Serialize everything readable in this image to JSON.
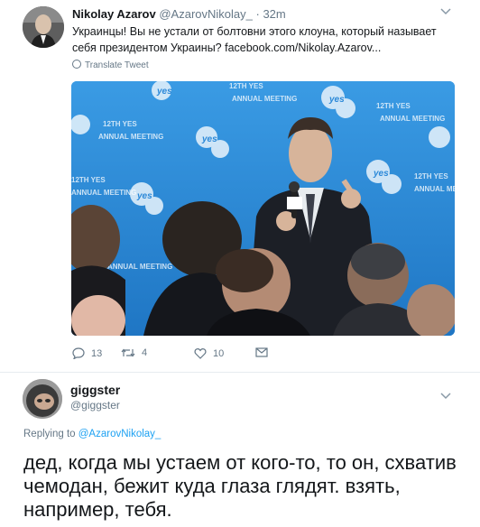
{
  "tweet1": {
    "author_name": "Nikolay Azarov",
    "author_handle": "@AzarovNikolay_",
    "time": "· 32m",
    "text": "Украинцы! Вы не устали от болтовни этого клоуна, который называет себя президентом Украины? facebook.com/Nikolay.Azarov...",
    "translate_label": "Translate Tweet",
    "photo_backdrop_texts": [
      "12TH YES",
      "ANNUAL MEETING"
    ],
    "photo_logo_text": "yes",
    "actions": {
      "replies": "13",
      "retweets": "4",
      "likes": "10"
    }
  },
  "tweet2": {
    "author_name": "giggster",
    "author_handle": "@giggster",
    "replying_prefix": "Replying to",
    "replying_to": "@AzarovNikolay_",
    "text": "дед, когда мы устаем от кого-то, то он, схватив чемодан, бежит куда глаза глядят. взять, например, тебя."
  },
  "colors": {
    "link": "#1da1f2",
    "secondary": "#657786",
    "text": "#14171a",
    "backdrop": "#2d8fdc"
  },
  "icons": [
    "reply-icon",
    "retweet-icon",
    "like-icon",
    "dm-icon",
    "globe-icon",
    "chevron-down-icon"
  ]
}
